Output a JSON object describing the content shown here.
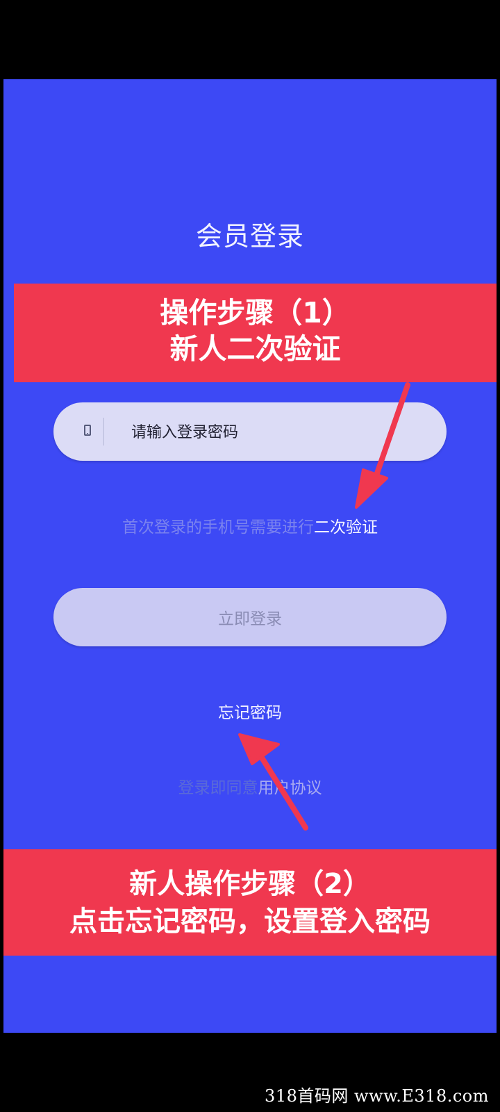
{
  "colors": {
    "screen_bg": "#3d49f5",
    "banner_bg": "#f0384f",
    "field_bg": "#dcdcf6",
    "button_bg": "#c9c9f3",
    "arrow": "#f0384f"
  },
  "header": {
    "title": "会员登录"
  },
  "annotations": {
    "step1": {
      "line1": "操作步骤（1）",
      "line2": "新人二次验证"
    },
    "step2": {
      "line1": "新人操作步骤（2）",
      "line2": "点击忘记密码，设置登入密码"
    }
  },
  "form": {
    "field_icon": "phone-icon",
    "password_placeholder": "请输入登录密码",
    "verify_note_prefix": "首次登录的手机号需要进行",
    "verify_note_link": "二次验证",
    "login_button_label": "立即登录",
    "forgot_password_label": "忘记密码",
    "agreement_prefix": "登录即同意",
    "agreement_link": "用户协议"
  },
  "watermark": "318首码网 www.E318.com"
}
